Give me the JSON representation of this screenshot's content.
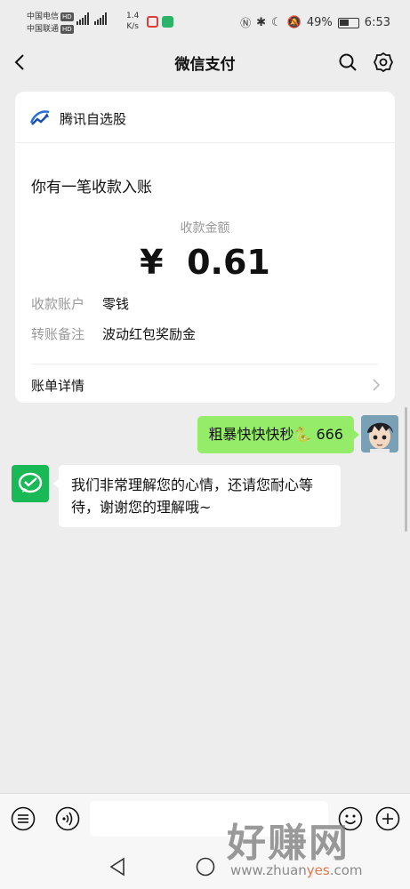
{
  "status_bar": {
    "carrier_1": "中国电信",
    "carrier_2": "中国联通",
    "hd_badge": "HD",
    "speed_value": "1.4",
    "speed_unit": "K/s",
    "battery_percent": "49%",
    "time": "6:53"
  },
  "nav": {
    "title": "微信支付"
  },
  "card": {
    "brand": "腾讯自选股",
    "headline": "你有一笔收款入账",
    "amount_label": "收款金额",
    "amount": "¥  0.61",
    "rows": [
      {
        "key": "收款账户",
        "value": "零钱"
      },
      {
        "key": "转账备注",
        "value": "波动红包奖励金"
      }
    ],
    "detail_link": "账单详情"
  },
  "chat": {
    "user_message": "粗暴快快快秒🐍 666",
    "bot_message": "我们非常理解您的心情，还请您耐心等待，谢谢您的理解哦~"
  },
  "watermark": {
    "text_cn": "好赚网",
    "url_pre": "www.zhuan",
    "url_accent": "yes",
    "url_post": ".com"
  },
  "colors": {
    "background": "#ededed",
    "user_bubble": "#95ec69",
    "wechat_green": "#19b955"
  }
}
